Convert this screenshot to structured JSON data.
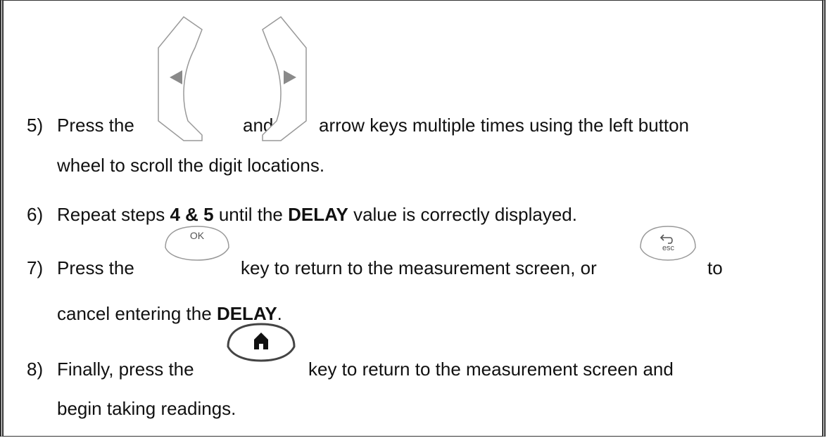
{
  "steps": [
    {
      "number": "5)",
      "line1_before": "Press the",
      "line1_mid": "and",
      "line1_after": "arrow keys multiple times using the left button",
      "line2": "wheel to scroll the digit locations."
    },
    {
      "number": "6)",
      "text_before": "Repeat steps ",
      "bold1": "4 & 5",
      "text_mid": " until the ",
      "bold2": "DELAY",
      "text_after": " value is correctly displayed."
    },
    {
      "number": "7)",
      "line1_before": "Press the",
      "line1_mid": "key to return to the measurement screen, or",
      "line1_after": "to",
      "line2_before": "cancel entering the ",
      "line2_bold": "DELAY",
      "line2_after": "."
    },
    {
      "number": "8)",
      "line1_before": "Finally, press the",
      "line1_after": "key to return to the measurement screen and",
      "line2": "begin taking readings."
    }
  ],
  "keys": {
    "left_arrow_icon": "left-arrow-key",
    "right_arrow_icon": "right-arrow-key",
    "ok_label": "OK",
    "esc_label": "esc",
    "home_icon": "home-icon"
  }
}
